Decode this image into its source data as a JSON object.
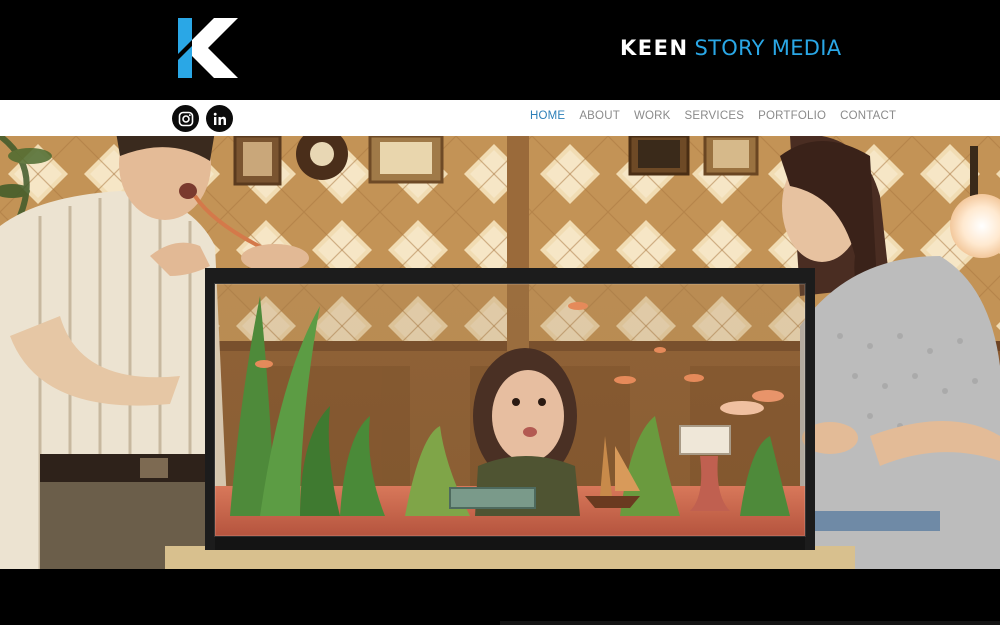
{
  "header": {
    "brand_primary": "KEEN",
    "brand_secondary": "STORY MEDIA",
    "logo_icon": "keen-k-logo-icon",
    "colors": {
      "accent": "#2aa7e6",
      "nav_active": "#2c7fb8",
      "nav_text": "#8a8a8a"
    }
  },
  "social": [
    {
      "icon": "instagram-icon"
    },
    {
      "icon": "linkedin-icon"
    }
  ],
  "nav": {
    "items": [
      "HOME",
      "ABOUT",
      "WORK",
      "SERVICES",
      "PORTFOLIO",
      "CONTACT"
    ],
    "active": "HOME"
  },
  "hero": {
    "scene": "video-still"
  }
}
